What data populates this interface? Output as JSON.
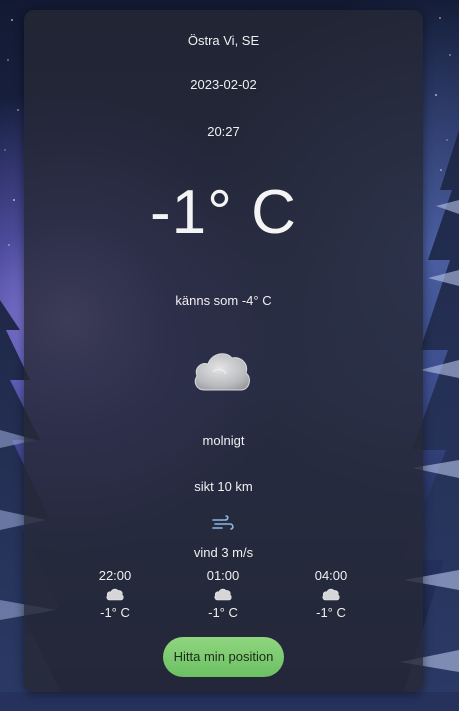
{
  "location": "Östra Vi, SE",
  "date": "2023-02-02",
  "time": "20:27",
  "temperature": "-1° C",
  "feels_like": "känns som -4° C",
  "condition_icon": "cloud-icon",
  "condition": "molnigt",
  "visibility": "sikt 10 km",
  "wind_icon": "wind-icon",
  "wind": "vind 3 m/s",
  "forecast": [
    {
      "time": "22:00",
      "icon": "cloud-icon",
      "temp": "-1° C"
    },
    {
      "time": "01:00",
      "icon": "cloud-icon",
      "temp": "-1° C"
    },
    {
      "time": "04:00",
      "icon": "cloud-icon",
      "temp": "-1° C"
    }
  ],
  "button_label": "Hitta min position",
  "colors": {
    "card": "#26283499",
    "button": "#7ccb6e",
    "text": "#f0f0f0"
  }
}
